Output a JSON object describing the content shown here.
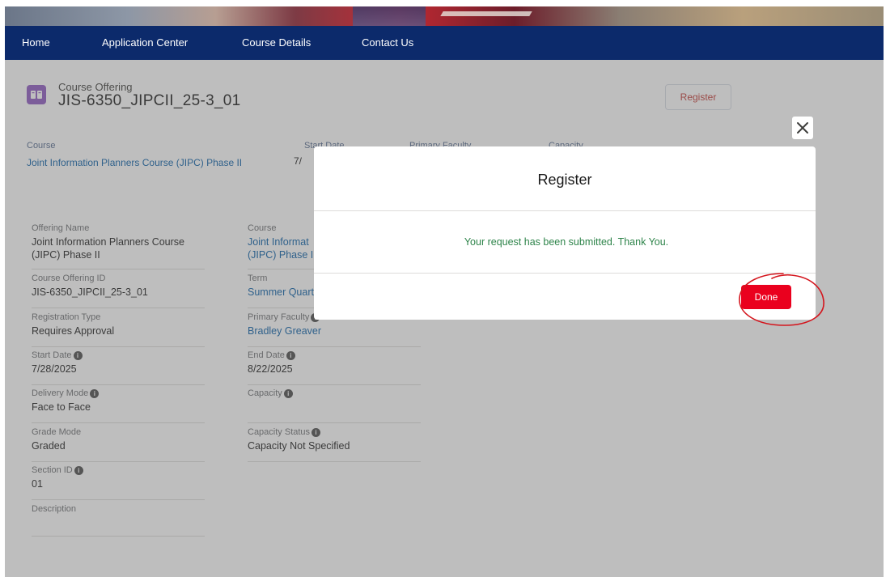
{
  "nav": {
    "items": [
      "Home",
      "Application Center",
      "Course Details",
      "Contact Us"
    ]
  },
  "record": {
    "type_label": "Course Offering",
    "title": "JIS-6350_JIPCII_25-3_01",
    "register_button": "Register"
  },
  "highlights": [
    {
      "label": "Course",
      "value": "Joint Information Planners Course (JIPC) Phase II"
    },
    {
      "label": "Start Date",
      "value": "7/"
    },
    {
      "label": "Primary Faculty",
      "value": ""
    },
    {
      "label": "Capacity",
      "value": ""
    }
  ],
  "details": {
    "offering_name": {
      "label": "Offering Name",
      "value_line1": "Joint Information Planners Course",
      "value_line2": "(JIPC) Phase II"
    },
    "course": {
      "label": "Course",
      "value_line1": "Joint Informat",
      "value_line2": "(JIPC) Phase II"
    },
    "offering_id": {
      "label": "Course Offering ID",
      "value": "JIS-6350_JIPCII_25-3_01"
    },
    "term": {
      "label": "Term",
      "value": "Summer Quart"
    },
    "registration_type": {
      "label": "Registration Type",
      "value": "Requires Approval"
    },
    "primary_faculty": {
      "label": "Primary Faculty",
      "value": "Bradley Greaver"
    },
    "start_date": {
      "label": "Start Date",
      "value": "7/28/2025"
    },
    "end_date": {
      "label": "End Date",
      "value": "8/22/2025"
    },
    "delivery_mode": {
      "label": "Delivery Mode",
      "value": "Face to Face"
    },
    "capacity": {
      "label": "Capacity",
      "value": ""
    },
    "grade_mode": {
      "label": "Grade Mode",
      "value": "Graded"
    },
    "capacity_status": {
      "label": "Capacity Status",
      "value": "Capacity Not Specified"
    },
    "section_id": {
      "label": "Section ID",
      "value": "01"
    },
    "description": {
      "label": "Description",
      "value": ""
    }
  },
  "modal": {
    "title": "Register",
    "message": "Your request has been submitted. Thank You.",
    "done_button": "Done"
  },
  "colors": {
    "navbar": "#0c2a6b",
    "done_button": "#ea001e",
    "success_text": "#2e844a",
    "link": "#0a5fa8",
    "annotation": "#d4141c"
  }
}
